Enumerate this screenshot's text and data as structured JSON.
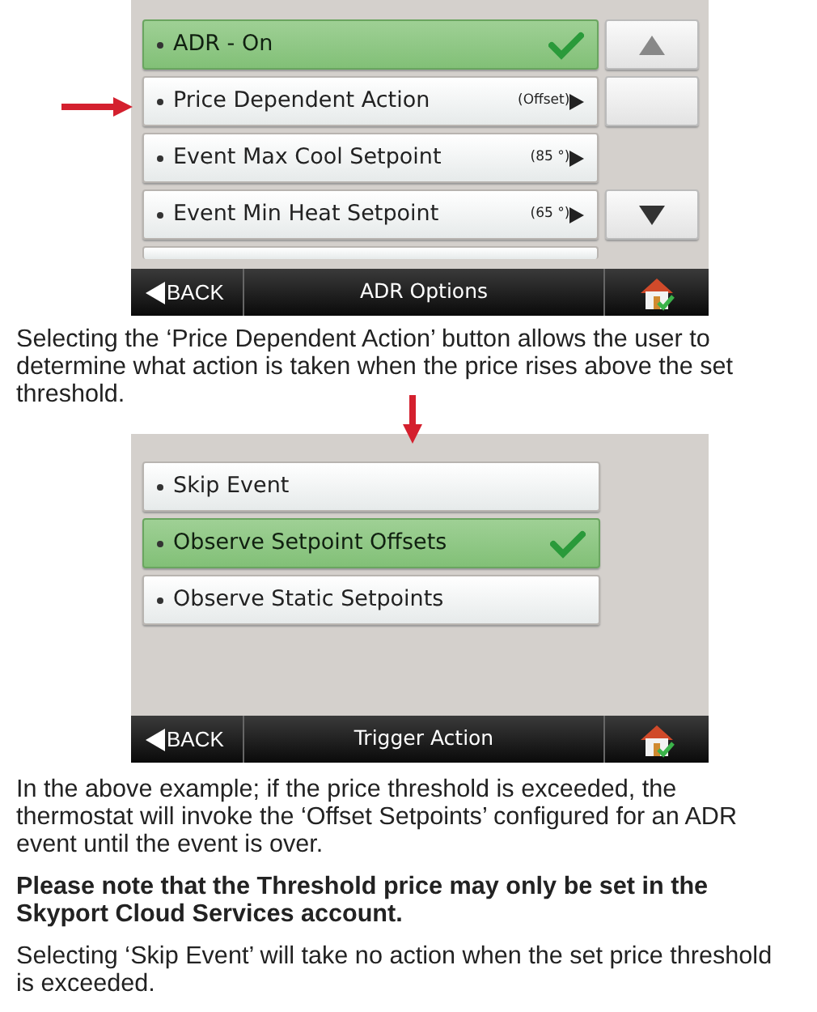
{
  "screens": [
    {
      "items": [
        {
          "label": "ADR - On",
          "selected": true
        },
        {
          "label": "Price Dependent Action",
          "value": "(Offset)",
          "selected": false
        },
        {
          "label": "Event Max Cool Setpoint",
          "value": "(85 °)",
          "selected": false
        },
        {
          "label": "Event Min Heat Setpoint",
          "value": "(65 °)",
          "selected": false
        },
        {
          "kind": "partial"
        }
      ],
      "scroll_buttons": [
        {
          "kind": "up"
        },
        {
          "kind": "blank"
        },
        {
          "kind": "spacer"
        },
        {
          "kind": "down"
        }
      ],
      "back_label": "BACK",
      "title": "ADR Options"
    },
    {
      "items": [
        {
          "label": "Skip Event",
          "selected": false
        },
        {
          "label": "Observe Setpoint Offsets",
          "selected": true
        },
        {
          "label": "Observe Static Setpoints",
          "selected": false
        }
      ],
      "back_label": "BACK",
      "title": "Trigger Action"
    }
  ],
  "paragraphs": [
    {
      "text": "Selecting the ‘Price Dependent Action’ button allows the user to determine what action is taken when the price rises above the set threshold.",
      "bold": false
    },
    {
      "text": "In the above example; if the price threshold is exceeded, the thermostat will invoke the ‘Offset Setpoints’ configured for an ADR event until the event is over.",
      "bold": false
    },
    {
      "text": "Please note that the Threshold price may only be set in the Skyport Cloud Services account.",
      "bold": true
    },
    {
      "text": "Selecting ‘Skip Event’ will take no action when the set price threshold is exceeded.",
      "bold": false
    }
  ]
}
